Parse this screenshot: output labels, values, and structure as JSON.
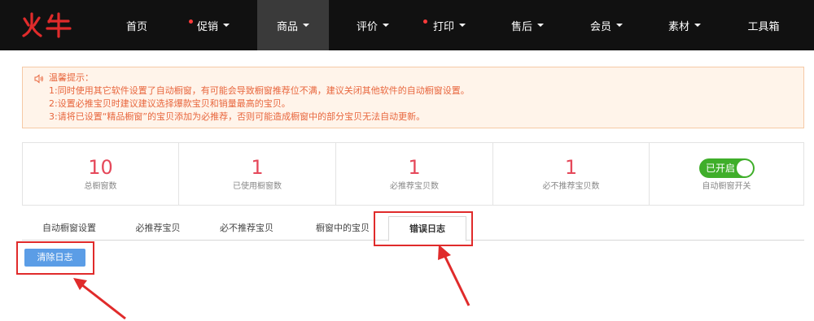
{
  "brand": {
    "logo_text": "火牛"
  },
  "nav": {
    "items": [
      {
        "label": "首页",
        "caret": false,
        "dot": false
      },
      {
        "label": "促销",
        "caret": true,
        "dot": true
      },
      {
        "label": "商品",
        "caret": true,
        "dot": false,
        "active": true
      },
      {
        "label": "评价",
        "caret": true,
        "dot": false
      },
      {
        "label": "打印",
        "caret": true,
        "dot": true
      },
      {
        "label": "售后",
        "caret": true,
        "dot": false
      },
      {
        "label": "会员",
        "caret": true,
        "dot": false
      },
      {
        "label": "素材",
        "caret": true,
        "dot": false
      },
      {
        "label": "工具箱",
        "caret": false,
        "dot": false
      }
    ]
  },
  "notice": {
    "title": "温馨提示：",
    "lines": [
      "1:同时使用其它软件设置了自动橱窗，有可能会导致橱窗推荐位不满，建议关闭其他软件的自动橱窗设置。",
      "2:设置必推宝贝时建议建议选择爆款宝贝和销量最高的宝贝。",
      "3:请将已设置“精品橱窗”的宝贝添加为必推荐，否则可能造成橱窗中的部分宝贝无法自动更新。"
    ]
  },
  "stats": [
    {
      "value": "10",
      "label": "总橱窗数"
    },
    {
      "value": "1",
      "label": "已使用橱窗数"
    },
    {
      "value": "1",
      "label": "必推荐宝贝数"
    },
    {
      "value": "1",
      "label": "必不推荐宝贝数"
    }
  ],
  "auto_switch": {
    "state_label": "已开启",
    "label": "自动橱窗开关",
    "on": true
  },
  "tabs": [
    {
      "label": "自动橱窗设置"
    },
    {
      "label": "必推荐宝贝"
    },
    {
      "label": "必不推荐宝贝"
    },
    {
      "label": "橱窗中的宝贝"
    },
    {
      "label": "错误日志",
      "active": true
    }
  ],
  "actions": {
    "clear_log": "清除日志"
  },
  "colors": {
    "accent_red": "#e5485a",
    "notice_text": "#e8663d",
    "button_blue": "#5b9de6",
    "toggle_green": "#3fae2a",
    "annotation_red": "#e02b2b"
  }
}
